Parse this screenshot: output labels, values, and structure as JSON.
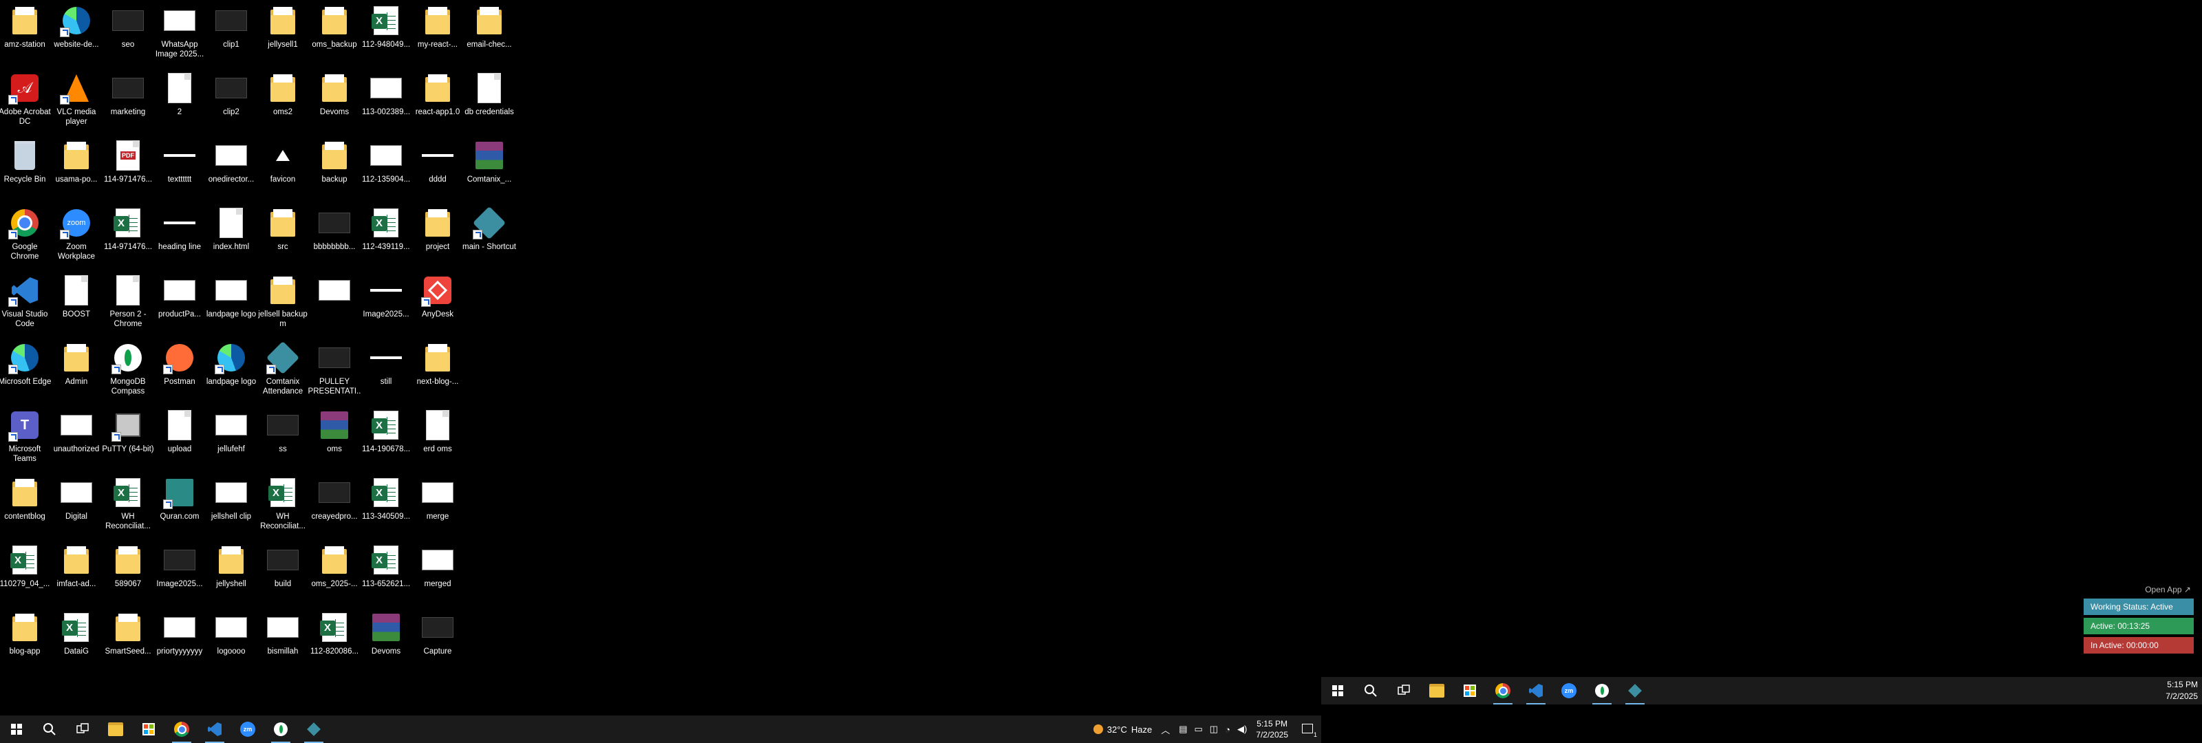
{
  "desktop_icons": [
    {
      "label": "amz-station",
      "type": "folder"
    },
    {
      "label": "website-de...",
      "type": "edge"
    },
    {
      "label": "seo",
      "type": "thumb-dark"
    },
    {
      "label": "WhatsApp Image 2025...",
      "type": "thumb"
    },
    {
      "label": "clip1",
      "type": "thumb-dark"
    },
    {
      "label": "jellysell1",
      "type": "folder"
    },
    {
      "label": "oms_backup",
      "type": "folder"
    },
    {
      "label": "112-948049...",
      "type": "excel"
    },
    {
      "label": "my-react-...",
      "type": "folder"
    },
    {
      "label": "email-chec...",
      "type": "folder"
    },
    {
      "label": "Adobe Acrobat DC",
      "type": "acrobat"
    },
    {
      "label": "VLC media player",
      "type": "vlc"
    },
    {
      "label": "marketing",
      "type": "thumb-dark"
    },
    {
      "label": "2",
      "type": "doc"
    },
    {
      "label": "clip2",
      "type": "thumb-dark"
    },
    {
      "label": "oms2",
      "type": "folder"
    },
    {
      "label": "Devoms",
      "type": "folder"
    },
    {
      "label": "113-002389...",
      "type": "thumb"
    },
    {
      "label": "react-app1.0",
      "type": "folder"
    },
    {
      "label": "db credentials",
      "type": "doc"
    },
    {
      "label": "Recycle Bin",
      "type": "recycle"
    },
    {
      "label": "usama-po...",
      "type": "folder"
    },
    {
      "label": "114-971476...",
      "type": "pdf"
    },
    {
      "label": "textttttt",
      "type": "line"
    },
    {
      "label": "onedirector...",
      "type": "thumb"
    },
    {
      "label": "favicon",
      "type": "triangle"
    },
    {
      "label": "backup",
      "type": "folder"
    },
    {
      "label": "112-135904...",
      "type": "thumb"
    },
    {
      "label": "dddd",
      "type": "line"
    },
    {
      "label": "Comtanix_...",
      "type": "rar"
    },
    {
      "label": "Google Chrome",
      "type": "chrome"
    },
    {
      "label": "Zoom Workplace",
      "type": "zoom"
    },
    {
      "label": "114-971476...",
      "type": "excel"
    },
    {
      "label": "heading line",
      "type": "line"
    },
    {
      "label": "index.html",
      "type": "doc"
    },
    {
      "label": "src",
      "type": "folder"
    },
    {
      "label": "bbbbbbbb...",
      "type": "thumb-dark"
    },
    {
      "label": "112-439119...",
      "type": "excel"
    },
    {
      "label": "project",
      "type": "folder"
    },
    {
      "label": "main - Shortcut",
      "type": "diamond"
    },
    {
      "label": "Visual Studio Code",
      "type": "vscode"
    },
    {
      "label": "BOOST",
      "type": "doc"
    },
    {
      "label": "Person 2 - Chrome",
      "type": "doc"
    },
    {
      "label": "productPa...",
      "type": "thumb"
    },
    {
      "label": "landpage logo",
      "type": "thumb"
    },
    {
      "label": "jellsell backup m",
      "type": "folder"
    },
    {
      "label": "",
      "type": "thumb"
    },
    {
      "label": "Image2025...",
      "type": "line"
    },
    {
      "label": "AnyDesk",
      "type": "anydesk"
    },
    {
      "label": "",
      "type": "none"
    },
    {
      "label": "Microsoft Edge",
      "type": "edge"
    },
    {
      "label": "Admin",
      "type": "folder"
    },
    {
      "label": "MongoDB Compass",
      "type": "mongo"
    },
    {
      "label": "Postman",
      "type": "postman"
    },
    {
      "label": "landpage logo",
      "type": "edge"
    },
    {
      "label": "Comtanix Attendance",
      "type": "diamond"
    },
    {
      "label": "PULLEY PRESENTATI...",
      "type": "thumb-dark"
    },
    {
      "label": "still",
      "type": "line"
    },
    {
      "label": "next-blog-...",
      "type": "folder"
    },
    {
      "label": "",
      "type": "none"
    },
    {
      "label": "Microsoft Teams",
      "type": "teams"
    },
    {
      "label": "unauthorized",
      "type": "thumb"
    },
    {
      "label": "PuTTY (64-bit)",
      "type": "putty"
    },
    {
      "label": "upload",
      "type": "doc"
    },
    {
      "label": "jellufehf",
      "type": "thumb"
    },
    {
      "label": "ss",
      "type": "thumb-dark"
    },
    {
      "label": "oms",
      "type": "rar"
    },
    {
      "label": "114-190678...",
      "type": "excel"
    },
    {
      "label": "erd oms",
      "type": "doc"
    },
    {
      "label": "",
      "type": "none"
    },
    {
      "label": "contentblog",
      "type": "folder"
    },
    {
      "label": "Digital",
      "type": "thumb"
    },
    {
      "label": "WH Reconciliat...",
      "type": "excel"
    },
    {
      "label": "Quran.com",
      "type": "quran"
    },
    {
      "label": "jellshell clip",
      "type": "thumb"
    },
    {
      "label": "WH Reconciliat...",
      "type": "excel"
    },
    {
      "label": "creayedpro...",
      "type": "thumb-dark"
    },
    {
      "label": "113-340509...",
      "type": "excel"
    },
    {
      "label": "merge",
      "type": "thumb"
    },
    {
      "label": "",
      "type": "none"
    },
    {
      "label": "110279_04_...",
      "type": "excel"
    },
    {
      "label": "imfact-ad...",
      "type": "folder"
    },
    {
      "label": "589067",
      "type": "folder"
    },
    {
      "label": "Image2025...",
      "type": "thumb-dark"
    },
    {
      "label": "jellyshell",
      "type": "folder"
    },
    {
      "label": "build",
      "type": "thumb-dark"
    },
    {
      "label": "oms_2025-...",
      "type": "folder"
    },
    {
      "label": "113-652621...",
      "type": "excel"
    },
    {
      "label": "merged",
      "type": "thumb"
    },
    {
      "label": "",
      "type": "none"
    },
    {
      "label": "blog-app",
      "type": "folder"
    },
    {
      "label": "DataiG",
      "type": "excel"
    },
    {
      "label": "SmartSeed...",
      "type": "folder"
    },
    {
      "label": "priortyyyyyyy",
      "type": "thumb"
    },
    {
      "label": "logoooo",
      "type": "thumb"
    },
    {
      "label": "bismillah",
      "type": "thumb"
    },
    {
      "label": "112-820086...",
      "type": "excel"
    },
    {
      "label": "Devoms",
      "type": "rar"
    },
    {
      "label": "Capture",
      "type": "thumb-dark"
    },
    {
      "label": "",
      "type": "none"
    }
  ],
  "taskbar1": {
    "weather_temp": "32°C",
    "weather_desc": "Haze",
    "time": "5:15 PM",
    "date": "7/2/2025",
    "notification_count": "1"
  },
  "taskbar2": {
    "time": "5:15 PM",
    "date": "7/2/2025"
  },
  "widget": {
    "open_label": "Open App ↗",
    "status": "Working Status: Active",
    "active": "Active: 00:13:25",
    "inactive": "In Active: 00:00:00",
    "colors": {
      "status": "#3a8fa6",
      "active": "#2e9a57",
      "inactive": "#b53a36"
    }
  }
}
